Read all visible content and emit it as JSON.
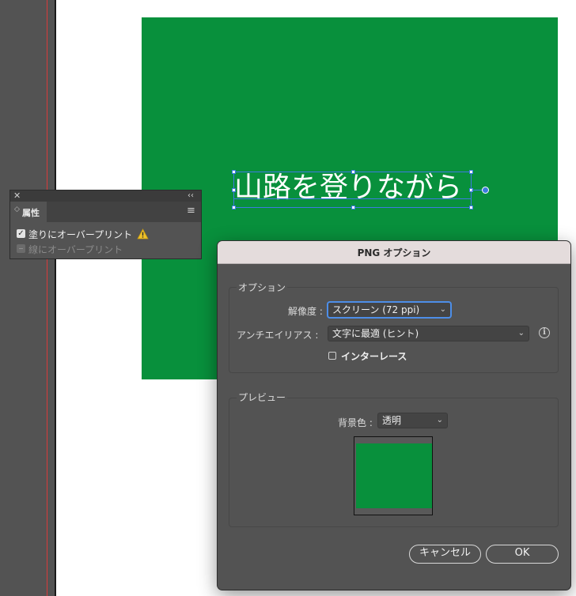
{
  "canvas": {
    "artboard_color": "#08903c",
    "artboard_text": "山路を登りながら",
    "selection_color": "#3d7be0"
  },
  "attributes_panel": {
    "tab_label": "属性",
    "fill_overprint_label": "塗りにオーバープリント",
    "fill_overprint_checked": true,
    "stroke_overprint_label": "線にオーバープリント",
    "stroke_overprint_enabled": false,
    "close_glyph": "✕",
    "collapse_glyph": "‹‹",
    "menu_glyph": "≡",
    "tab_arrows_glyph": "◇"
  },
  "png_dialog": {
    "title": "PNG オプション",
    "options_group": {
      "label": "オプション",
      "resolution_label": "解像度 :",
      "resolution_value": "スクリーン (72 ppi)",
      "antialias_label": "アンチエイリアス :",
      "antialias_value": "文字に最適 (ヒント)",
      "interlace_label": "インターレース",
      "interlace_checked": false
    },
    "preview_group": {
      "label": "プレビュー",
      "background_label": "背景色 :",
      "background_value": "透明"
    },
    "cancel_label": "キャンセル",
    "ok_label": "OK"
  },
  "icons": {
    "chevron": "⌄",
    "info": "i",
    "check": "✓"
  }
}
